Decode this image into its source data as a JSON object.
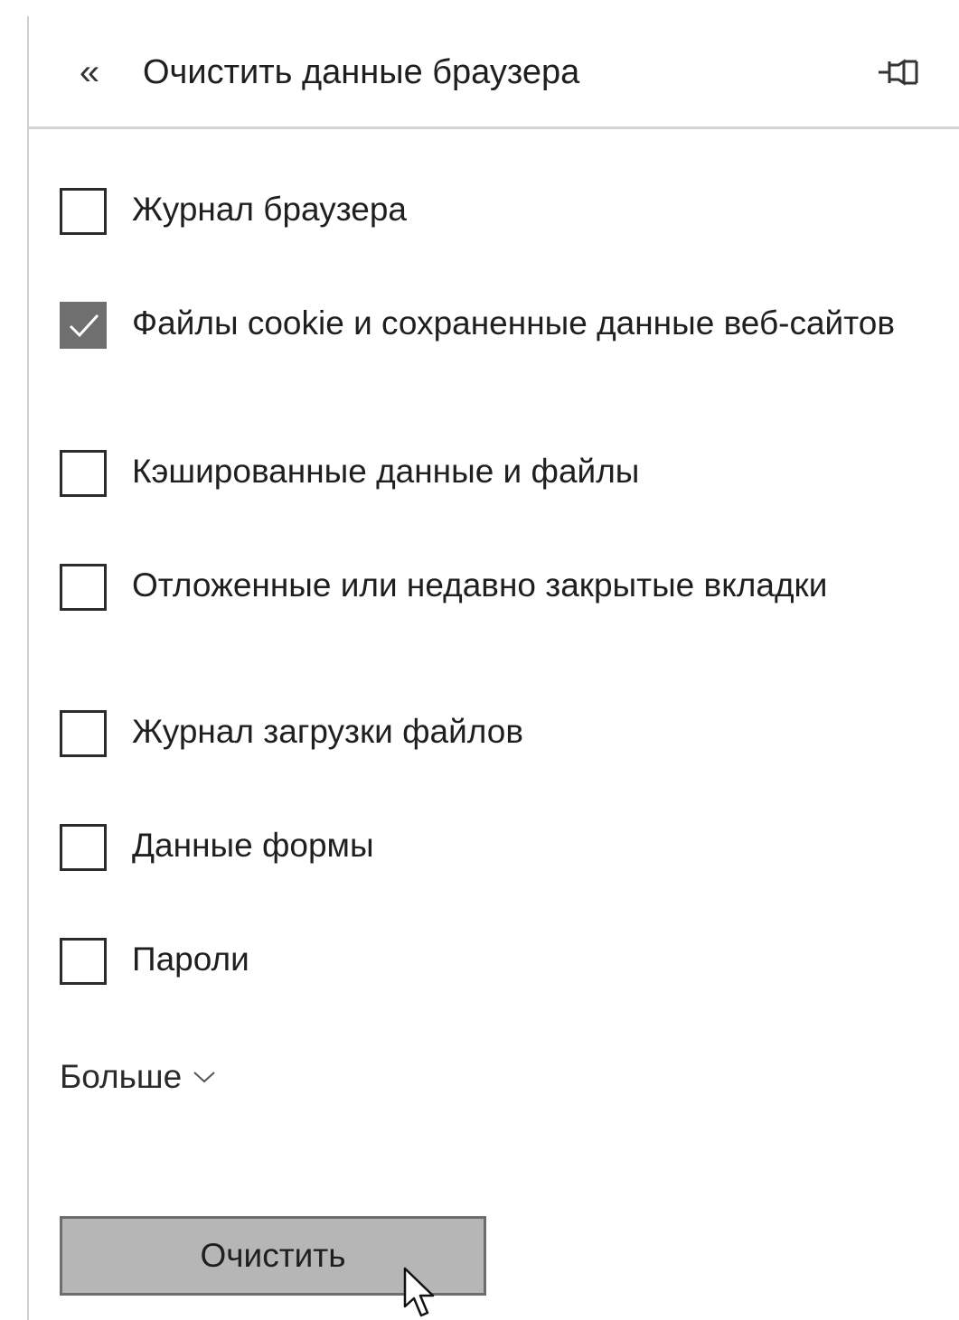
{
  "header": {
    "back_icon": "double-chevron-left-icon",
    "back_glyph": "«",
    "title": "Очистить данные браузера",
    "pin_icon": "pin-icon"
  },
  "options": [
    {
      "label": "Журнал браузера",
      "checked": false
    },
    {
      "label": "Файлы cookie и сохраненные данные веб-сайтов",
      "checked": true
    },
    {
      "label": "Кэшированные данные и файлы",
      "checked": false
    },
    {
      "label": "Отложенные или недавно закрытые вкладки",
      "checked": false
    },
    {
      "label": "Журнал загрузки файлов",
      "checked": false
    },
    {
      "label": "Данные формы",
      "checked": false
    },
    {
      "label": "Пароли",
      "checked": false
    }
  ],
  "more": {
    "label": "Больше",
    "icon": "chevron-down-icon"
  },
  "clear_button": {
    "label": "Очистить"
  },
  "colors": {
    "checked_fill": "#6f6f6f",
    "button_fill": "#b6b6b6",
    "divider": "#d4d4d4"
  }
}
